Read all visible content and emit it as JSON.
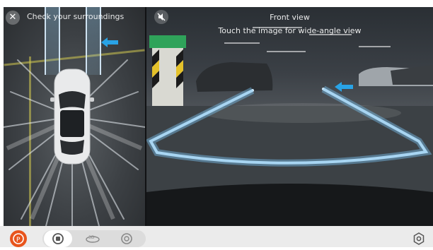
{
  "left_panel": {
    "hint": "Check your surroundings",
    "close_icon": "close-icon",
    "guide_arrow_color": "#29a3e6"
  },
  "right_panel": {
    "title": "Front view",
    "subtitle": "Touch the image for wide-angle view",
    "mute_icon": "mute-icon",
    "trajectory_color": "#cfe8f8",
    "guide_arrow_color": "#29a3e6"
  },
  "toolbar": {
    "parking_icon": "auto-parking-icon",
    "parking_color": "#e8541c",
    "modes": [
      {
        "icon": "standard-view-icon",
        "active": true
      },
      {
        "icon": "360-view-icon",
        "active": false
      },
      {
        "icon": "wheel-view-icon",
        "active": false
      }
    ],
    "settings_icon": "settings-icon"
  }
}
